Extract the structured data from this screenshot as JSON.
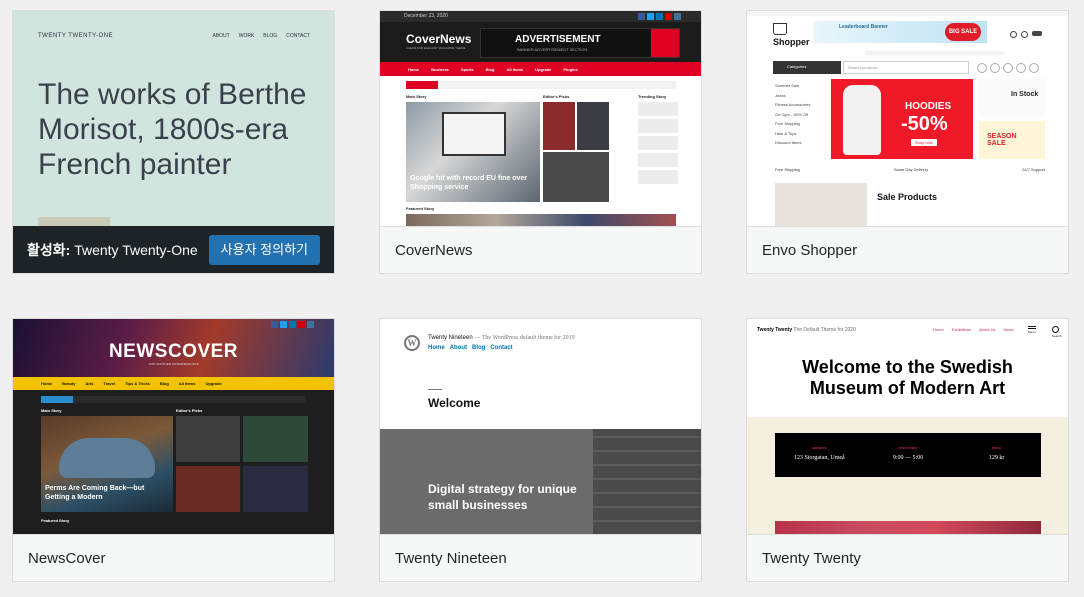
{
  "themes": [
    {
      "name": "Twenty Twenty-One",
      "active": true,
      "active_prefix": "활성화:",
      "customize_label": "사용자 정의하기",
      "preview": {
        "site_title": "TWENTY TWENTY-ONE",
        "nav": [
          "ABOUT",
          "WORK",
          "BLOG",
          "CONTACT"
        ],
        "headline": "The works of Berthe Morisot, 1800s-era French painter",
        "bg": "#d1e4dd"
      }
    },
    {
      "name": "CoverNews",
      "active": false,
      "preview": {
        "date": "December 23, 2020",
        "logo": "CoverNews",
        "tagline": "CLEAN AND ELEGANT MAGAZINE THEME",
        "ad_title": "ADVERTISEMENT",
        "ad_sub": "BANNER ADVERTISEMENT SECTION",
        "nav": [
          "Home",
          "Business",
          "Sports",
          "Blog",
          "All Items",
          "Upgrade",
          "Plugins"
        ],
        "sections": [
          "Main Story",
          "Editor's Picks",
          "Trending Story"
        ],
        "main_headline": "Google hit with record EU fine over Shopping service",
        "featured": "Featured Story",
        "accent": "#e00024"
      }
    },
    {
      "name": "Envo Shopper",
      "active": false,
      "preview": {
        "logo": "Shopper",
        "banner": "Leaderboard Banner",
        "big_sale": "BIG SALE",
        "categories_label": "Categories",
        "search_placeholder": "Search products...",
        "category_list": [
          "Summer Sale",
          "Jeans",
          "Fitness Accessories",
          "Go Gym - 30% Off",
          "Free Shipping",
          "Hats & Tops",
          "Discount Items"
        ],
        "hero_title": "HOODIES",
        "hero_discount": "-50%",
        "hero_cta": "Shop now",
        "side1": "In Stock",
        "side2": "SEASON SALE",
        "features": [
          "Free Shipping",
          "Same Day Delivery",
          "24/7 Support"
        ],
        "sale_products": "Sale Products",
        "accent": "#e11c2a"
      }
    },
    {
      "name": "NewsCover",
      "active": false,
      "preview": {
        "logo": "NEWSCOVER",
        "tagline": "JUST ANOTHER COVERNEWS SITE",
        "nav": [
          "Home",
          "Beauty",
          "Arts",
          "Travel",
          "Tips & Tricks",
          "Blog",
          "All Items",
          "Upgrade"
        ],
        "sections": [
          "Main Story",
          "Editor's Picks"
        ],
        "main_headline": "Perms Are Coming Back—but Getting a Modern",
        "featured": "Featured Story",
        "accent": "#f4c300"
      }
    },
    {
      "name": "Twenty Nineteen",
      "active": false,
      "preview": {
        "site_title": "Twenty Nineteen",
        "description": "— The WordPress default theme for 2019",
        "nav": [
          "Home",
          "About",
          "Blog",
          "Contact"
        ],
        "welcome": "Welcome",
        "hero": "Digital strategy for unique small businesses",
        "link_color": "#0073aa"
      }
    },
    {
      "name": "Twenty Twenty",
      "active": false,
      "preview": {
        "site_title": "Twenty Twenty",
        "description": "The Default Theme for 2020",
        "nav": [
          "Home",
          "Exhibitions",
          "About Us",
          "News"
        ],
        "menu_label": "Menu",
        "search_label": "Search",
        "headline": "Welcome to the Swedish Museum of Modern Art",
        "info_labels": [
          "ADDRESS",
          "OPEN TODAY",
          "PRICE"
        ],
        "info_values": [
          "123 Storgatan, Umeå",
          "9:00 — 5:00",
          "129 kr"
        ],
        "accent": "#cd2653",
        "bg": "#f5efe0"
      }
    }
  ]
}
